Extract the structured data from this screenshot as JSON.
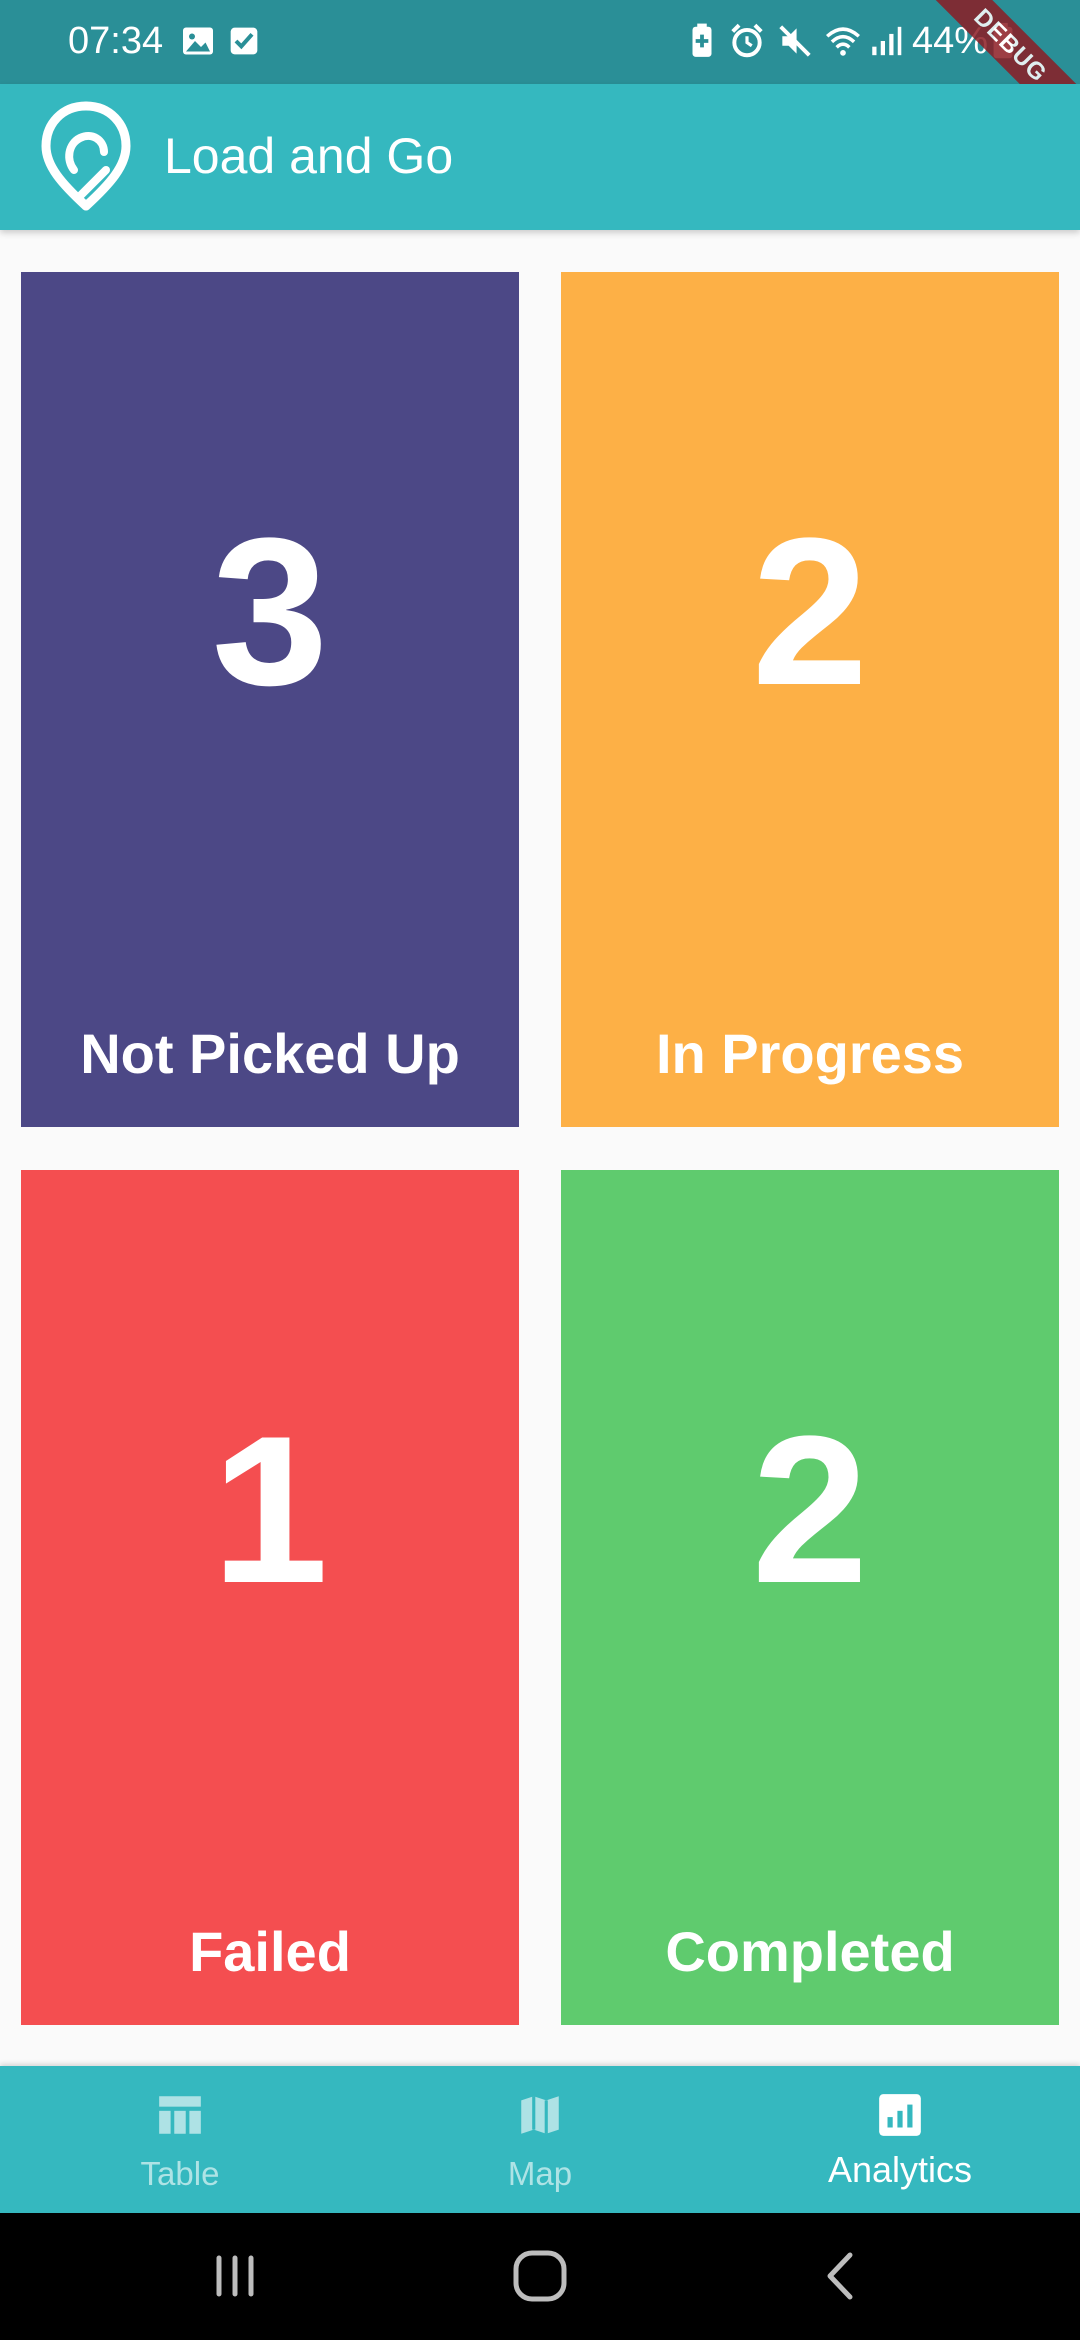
{
  "status_bar": {
    "time": "07:34",
    "battery_percent": "44%",
    "debug_banner": "DEBUG",
    "icons": [
      "image-icon",
      "checkbox-icon",
      "battery-saver-icon",
      "alarm-icon",
      "mute-icon",
      "wifi-icon",
      "signal-icon",
      "battery-icon"
    ]
  },
  "app_bar": {
    "title": "Load and Go",
    "logo_icon": "location-pin-logo-icon"
  },
  "tiles": [
    {
      "count": "3",
      "label": "Not Picked Up",
      "color": "#4c4886"
    },
    {
      "count": "2",
      "label": "In Progress",
      "color": "#fdb046"
    },
    {
      "count": "1",
      "label": "Failed",
      "color": "#f44e50"
    },
    {
      "count": "2",
      "label": "Completed",
      "color": "#5fcb6e"
    }
  ],
  "bottom_nav": {
    "items": [
      {
        "label": "Table",
        "icon": "table-icon",
        "active": false
      },
      {
        "label": "Map",
        "icon": "map-icon",
        "active": false
      },
      {
        "label": "Analytics",
        "icon": "analytics-icon",
        "active": true
      }
    ],
    "background": "#35b8bf"
  },
  "system_nav": {
    "icons": [
      "recents-icon",
      "home-icon",
      "back-icon"
    ]
  },
  "colors": {
    "status_bar": "#2a8f97",
    "app_bar": "#35b8bf",
    "background": "#fafafa"
  }
}
